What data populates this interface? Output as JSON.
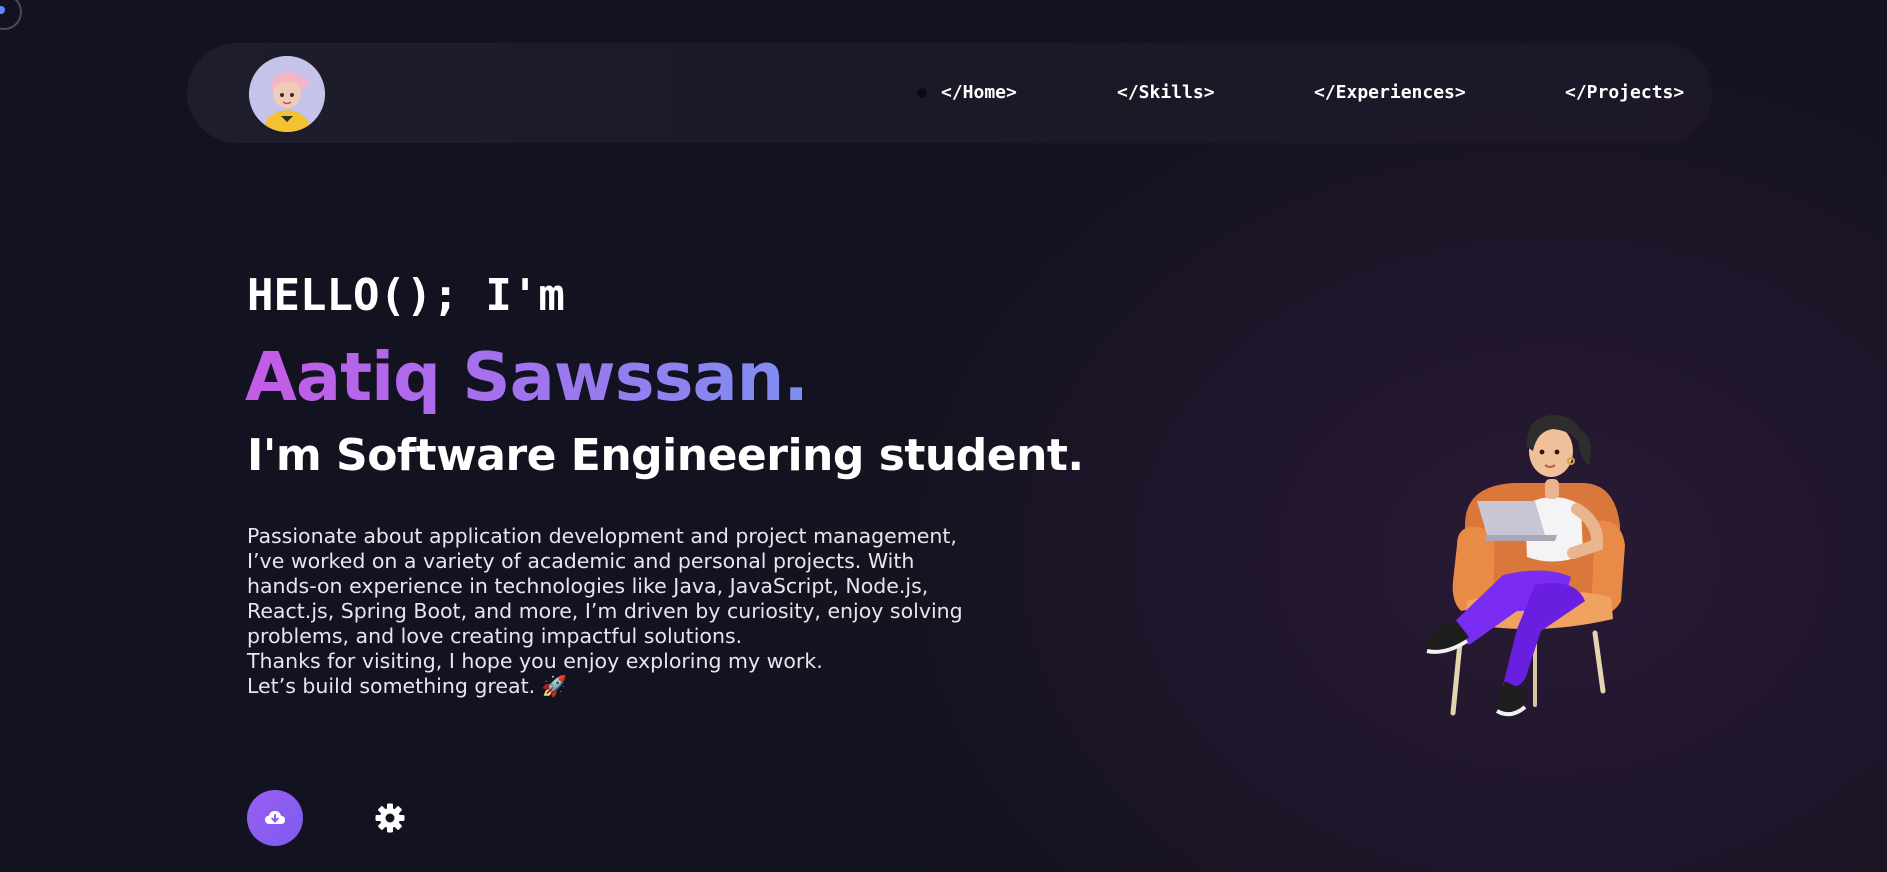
{
  "nav": {
    "links": [
      {
        "label": "</Home>"
      },
      {
        "label": "</Skills>"
      },
      {
        "label": "</Experiences>"
      },
      {
        "label": "</Projects>"
      }
    ]
  },
  "hero": {
    "greeting": "HELLO(); I'm",
    "name": "Aatiq Sawssan.",
    "role": "I'm Software Engineering student.",
    "bio": [
      "Passionate about application development and project management, I’ve worked on a variety of academic and personal projects. With hands-on experience in technologies like Java, JavaScript, Node.js, React.js, Spring Boot, and more, I’m driven by curiosity, enjoy solving problems, and love creating impactful solutions.",
      "Thanks for visiting, I hope you enjoy exploring my work.",
      "Let’s build something great. 🚀"
    ]
  },
  "actions": {
    "download_icon": "cloud-download-icon",
    "settings_icon": "gear-icon"
  },
  "colors": {
    "name_gradient_start": "#c55be6",
    "name_gradient_end": "#7f8ff2",
    "accent": "#8b5cf6"
  }
}
